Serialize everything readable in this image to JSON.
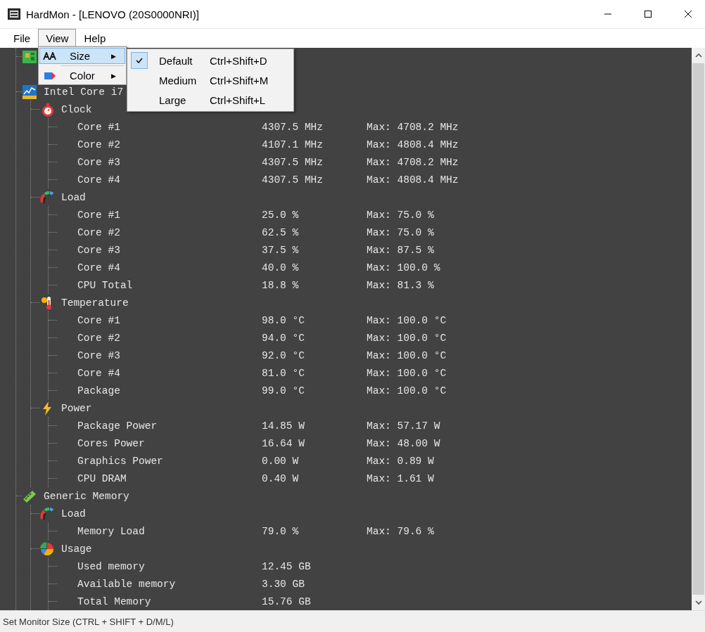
{
  "window": {
    "title": "HardMon - [LENOVO (20S0000NRI)]"
  },
  "menu_bar": [
    {
      "label": "File",
      "selected": false
    },
    {
      "label": "View",
      "selected": true
    },
    {
      "label": "Help",
      "selected": false
    }
  ],
  "view_menu": [
    {
      "kind": "size",
      "label": "Size",
      "selected": true,
      "arrow": "▶"
    },
    {
      "kind": "color",
      "label": "Color",
      "selected": false,
      "arrow": "▶"
    }
  ],
  "size_submenu": [
    {
      "label": "Default",
      "shortcut": "Ctrl+Shift+D",
      "checked": true
    },
    {
      "label": "Medium",
      "shortcut": "Ctrl+Shift+M",
      "checked": false
    },
    {
      "label": "Large",
      "shortcut": "Ctrl+Shift+L",
      "checked": false
    }
  ],
  "tree": [
    {
      "kind": "motherboard"
    },
    {
      "kind": "cpu",
      "name": "Intel Core i7",
      "groups": [
        {
          "kind": "clock",
          "name": "Clock",
          "sensors": [
            {
              "name": "Core #1",
              "value": "4307.5 MHz",
              "max": "Max: 4708.2 MHz"
            },
            {
              "name": "Core #2",
              "value": "4107.1 MHz",
              "max": "Max: 4808.4 MHz"
            },
            {
              "name": "Core #3",
              "value": "4307.5 MHz",
              "max": "Max: 4708.2 MHz"
            },
            {
              "name": "Core #4",
              "value": "4307.5 MHz",
              "max": "Max: 4808.4 MHz"
            }
          ]
        },
        {
          "kind": "load",
          "name": "Load",
          "sensors": [
            {
              "name": "Core #1",
              "value": "25.0 %",
              "max": "Max: 75.0 %"
            },
            {
              "name": "Core #2",
              "value": "62.5 %",
              "max": "Max: 75.0 %"
            },
            {
              "name": "Core #3",
              "value": "37.5 %",
              "max": "Max: 87.5 %"
            },
            {
              "name": "Core #4",
              "value": "40.0 %",
              "max": "Max: 100.0 %"
            },
            {
              "name": "CPU Total",
              "value": "18.8 %",
              "max": "Max: 81.3 %"
            }
          ]
        },
        {
          "kind": "temperature",
          "name": "Temperature",
          "sensors": [
            {
              "name": "Core #1",
              "value": "98.0 °C",
              "max": "Max: 100.0 °C"
            },
            {
              "name": "Core #2",
              "value": "94.0 °C",
              "max": "Max: 100.0 °C"
            },
            {
              "name": "Core #3",
              "value": "92.0 °C",
              "max": "Max: 100.0 °C"
            },
            {
              "name": "Core #4",
              "value": "81.0 °C",
              "max": "Max: 100.0 °C"
            },
            {
              "name": "Package",
              "value": "99.0 °C",
              "max": "Max: 100.0 °C"
            }
          ]
        },
        {
          "kind": "power",
          "name": "Power",
          "sensors": [
            {
              "name": "Package Power",
              "value": "14.85 W",
              "max": "Max: 57.17 W"
            },
            {
              "name": "Cores Power",
              "value": "16.64 W",
              "max": "Max: 48.00 W"
            },
            {
              "name": "Graphics Power",
              "value": "0.00 W",
              "max": "Max: 0.89 W"
            },
            {
              "name": "CPU DRAM",
              "value": "0.40 W",
              "max": "Max: 1.61 W"
            }
          ]
        }
      ]
    },
    {
      "kind": "memory",
      "name": "Generic Memory",
      "groups": [
        {
          "kind": "load",
          "name": "Load",
          "sensors": [
            {
              "name": "Memory Load",
              "value": "79.0 %",
              "max": "Max: 79.6 %"
            }
          ]
        },
        {
          "kind": "usage",
          "name": "Usage",
          "sensors": [
            {
              "name": "Used memory",
              "value": "12.45 GB"
            },
            {
              "name": "Available memory",
              "value": "3.30 GB"
            },
            {
              "name": "Total Memory",
              "value": "15.76 GB"
            }
          ]
        }
      ]
    }
  ],
  "status_bar": "Set Monitor Size (CTRL + SHIFT + D/M/L)"
}
